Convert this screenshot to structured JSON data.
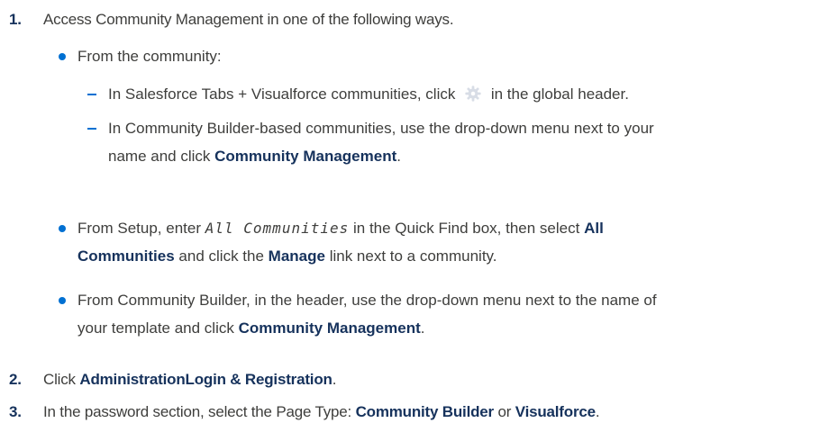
{
  "steps": [
    {
      "number": "1.",
      "text": "Access Community Management in one of the following ways.",
      "bullets": [
        {
          "text": "From the community:",
          "subitems": [
            {
              "before_icon": "In Salesforce Tabs + Visualforce communities, click",
              "icon": "gear-icon",
              "after_icon": "in the global header."
            },
            {
              "line1": "In Community Builder-based communities, use the drop-down menu next to your",
              "line2_plain": "name and click",
              "line2_bold": "Community Management",
              "line2_end": "."
            }
          ]
        },
        {
          "line1_plain": "From Setup, enter",
          "line1_code": "All Communities",
          "line1_plain2": "in the Quick Find box, then select",
          "line1_bold": "All",
          "line2_bold": "Communities",
          "line2_plain": "and click the",
          "line2_bold2": "Manage",
          "line2_end": "link next to a community."
        },
        {
          "line1": "From Community Builder, in the header, use the drop-down menu next to the name of",
          "line2_plain": "your template and click",
          "line2_bold": "Community Management",
          "line2_end": "."
        }
      ]
    },
    {
      "number": "2.",
      "plain": "Click",
      "bold": "AdministrationLogin & Registration",
      "end": "."
    },
    {
      "number": "3.",
      "plain": "In the password section, select the Page Type:",
      "bold1": "Community Builder",
      "mid": "or",
      "bold2": "Visualforce",
      "end": "."
    }
  ],
  "colors": {
    "accent": "#0070d2",
    "heading": "#16325c",
    "text": "#3e3e3c"
  }
}
